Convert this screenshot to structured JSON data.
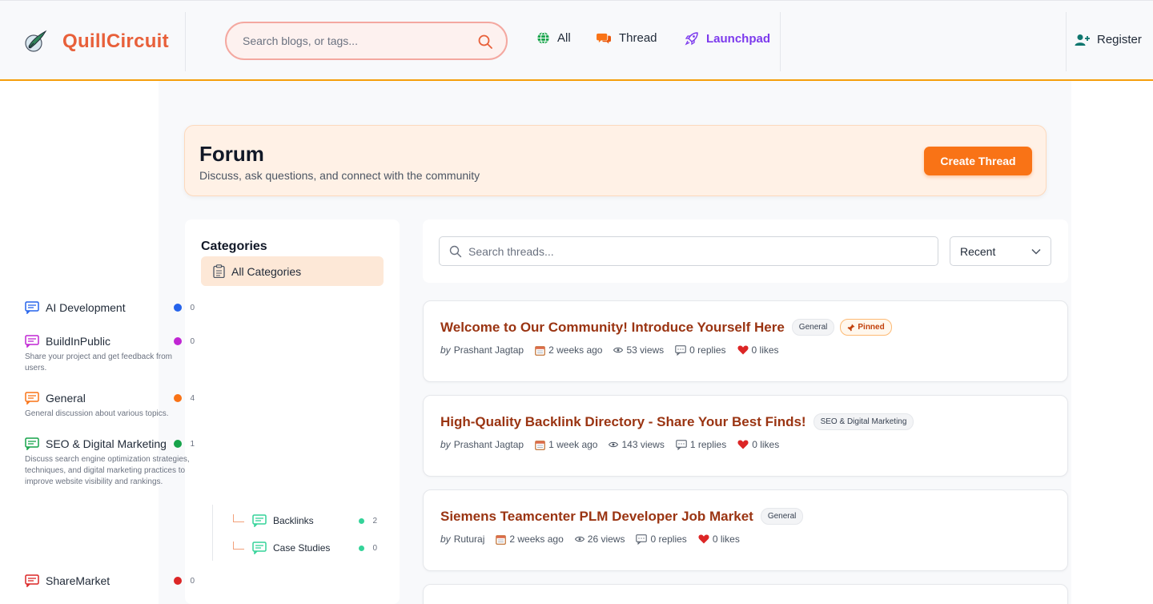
{
  "header": {
    "brand": "QuillCircuit",
    "search_placeholder": "Search blogs, or tags...",
    "nav": [
      {
        "label": "All",
        "icon": "globe-icon"
      },
      {
        "label": "Thread",
        "icon": "chat-icon"
      },
      {
        "label": "Launchpad",
        "icon": "rocket-icon"
      }
    ],
    "register_label": "Register"
  },
  "banner": {
    "title": "Forum",
    "subtitle": "Discuss, ask questions, and connect with the community",
    "create_button": "Create Thread"
  },
  "sidebar": {
    "title": "Categories",
    "all_label": "All Categories",
    "categories": [
      {
        "name": "AI Development",
        "count": "0",
        "color": "#2563eb",
        "description": ""
      },
      {
        "name": "BuildInPublic",
        "count": "0",
        "color": "#c026d3",
        "description": "Share your project and get feedback from users."
      },
      {
        "name": "General",
        "count": "4",
        "color": "#f97316",
        "description": "General discussion about various topics."
      },
      {
        "name": "SEO & Digital Marketing",
        "count": "1",
        "color": "#16a34a",
        "description": "Discuss search engine optimization strategies, techniques, and digital marketing practices to improve website visibility and rankings."
      },
      {
        "name": "ShareMarket",
        "count": "0",
        "color": "#dc2626",
        "description": ""
      }
    ],
    "subcategories": [
      {
        "name": "Backlinks",
        "count": "2",
        "color": "#34d399"
      },
      {
        "name": "Case Studies",
        "count": "0",
        "color": "#34d399"
      }
    ]
  },
  "threads_toolbar": {
    "search_placeholder": "Search threads...",
    "sort_value": "Recent"
  },
  "threads": [
    {
      "title": "Welcome to Our Community! Introduce Yourself Here",
      "tag": "General",
      "pinned": "Pinned",
      "by": "by",
      "author": "Prashant Jagtap",
      "date": "2 weeks ago",
      "views": "53 views",
      "replies": "0 replies",
      "likes": "0 likes"
    },
    {
      "title": "High-Quality Backlink Directory - Share Your Best Finds!",
      "tag": "SEO & Digital Marketing",
      "by": "by",
      "author": "Prashant Jagtap",
      "date": "1 week ago",
      "views": "143 views",
      "replies": "1 replies",
      "likes": "0 likes"
    },
    {
      "title": "Siemens Teamcenter PLM Developer Job Market",
      "tag": "General",
      "by": "by",
      "author": "Ruturaj",
      "date": "2 weeks ago",
      "views": "26 views",
      "replies": "0 replies",
      "likes": "0 likes"
    }
  ],
  "colors": {
    "brand": "#e8603a",
    "accent": "#f97316",
    "launchpad": "#7c3aed",
    "thread_title": "#9a3412"
  }
}
